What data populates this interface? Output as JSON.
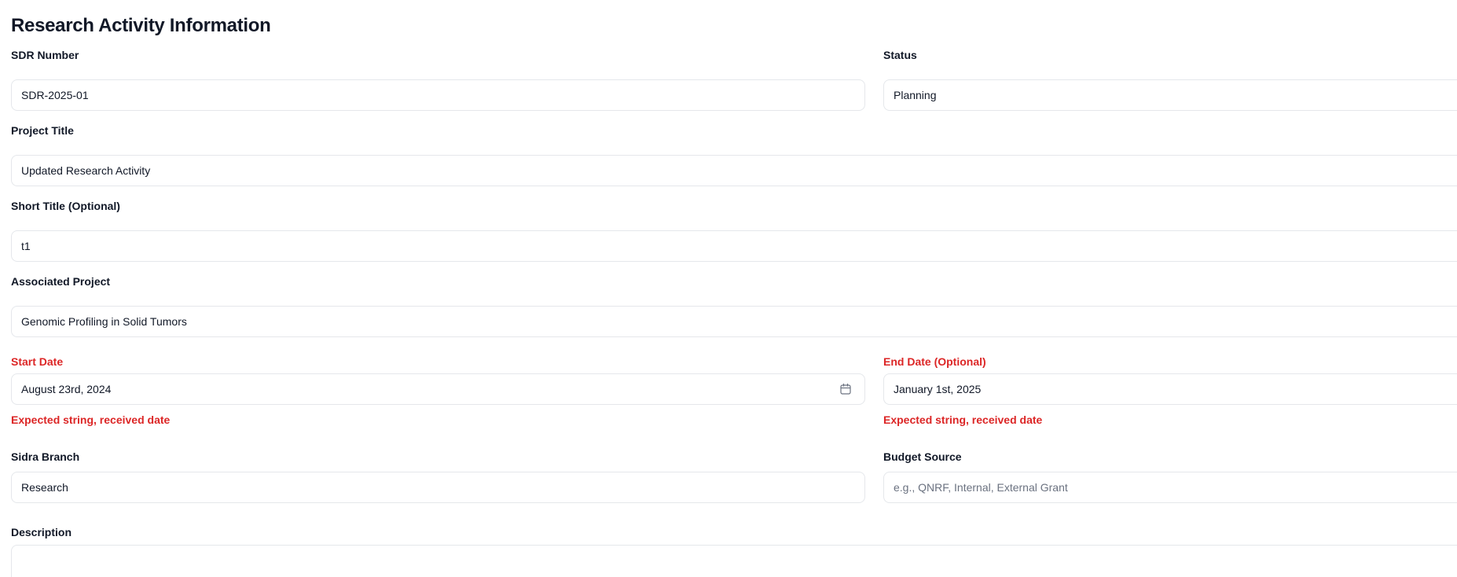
{
  "page": {
    "title": "Research Activity Information"
  },
  "form": {
    "sdr_number": {
      "label": "SDR Number",
      "value": "SDR-2025-01"
    },
    "status": {
      "label": "Status",
      "value": "Planning"
    },
    "project_title": {
      "label": "Project Title",
      "value": "Updated Research Activity"
    },
    "short_title": {
      "label": "Short Title (Optional)",
      "value": "t1"
    },
    "associated_project": {
      "label": "Associated Project",
      "value": "Genomic Profiling in Solid Tumors"
    },
    "start_date": {
      "label": "Start Date",
      "value": "August 23rd, 2024",
      "error": "Expected string, received date",
      "icon": "calendar-icon"
    },
    "end_date": {
      "label": "End Date (Optional)",
      "value": "January 1st, 2025",
      "error": "Expected string, received date"
    },
    "sidra_branch": {
      "label": "Sidra Branch",
      "value": "Research"
    },
    "budget_source": {
      "label": "Budget Source",
      "value": "",
      "placeholder": "e.g., QNRF, Internal, External Grant"
    },
    "description": {
      "label": "Description",
      "value": ""
    }
  },
  "colors": {
    "error": "#dc2626",
    "border": "#e5e7eb",
    "text": "#111827",
    "placeholder": "#6b7280"
  }
}
